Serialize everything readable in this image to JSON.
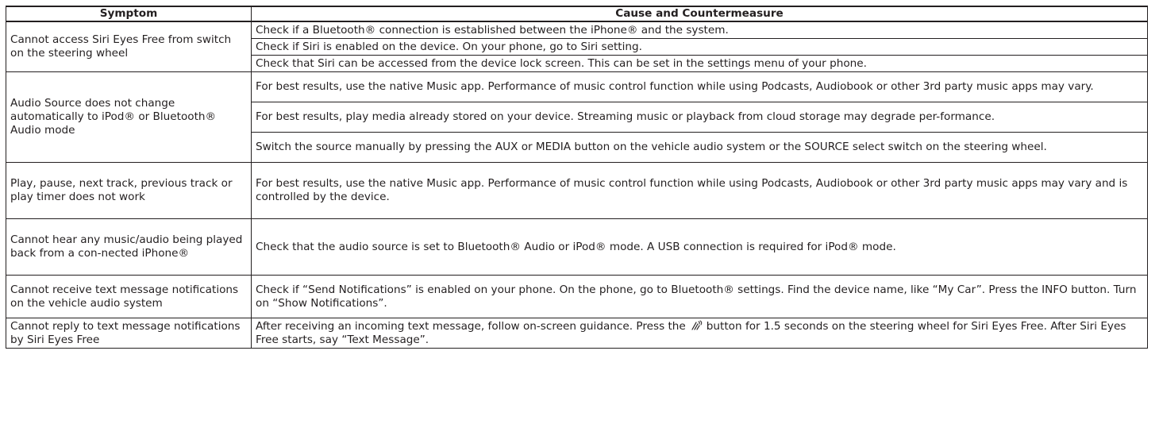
{
  "headers": {
    "symptom": "Symptom",
    "cause": "Cause and Countermeasure"
  },
  "rows": [
    {
      "symptom": "Cannot access Siri Eyes Free from switch on the steering wheel",
      "causes": [
        "Check if a Bluetooth® connection is established between the iPhone® and the system.",
        "Check if Siri is enabled on the device. On your phone, go to Siri setting.",
        "Check that Siri can be accessed from the device lock screen. This can be set in the settings menu of your phone."
      ]
    },
    {
      "symptom": "Audio Source does not change automatically to iPod® or Bluetooth® Audio mode",
      "causes": [
        "For best results, use the native Music app. Performance of music control function while using Podcasts, Audiobook or other 3rd party music apps may vary.",
        "For best results, play media already stored on your device. Streaming music or playback from cloud storage may degrade per-formance.",
        "Switch the source manually by pressing the AUX or MEDIA button on the vehicle audio system or the SOURCE select switch on the steering wheel."
      ]
    },
    {
      "symptom": "Play, pause, next track, previous track or play timer does not work",
      "causes": [
        "For best results, use the native Music app. Performance of music control function while using Podcasts, Audiobook or other 3rd party music apps may vary and is controlled by the device."
      ]
    },
    {
      "symptom": "Cannot hear any music/audio being played back from a con-nected iPhone®",
      "causes": [
        "Check that the audio source is set to Bluetooth® Audio or iPod® mode. A USB connection is required for iPod® mode."
      ]
    },
    {
      "symptom": "Cannot receive text message notifications on the vehicle audio system",
      "causes": [
        "Check if “Send Notifications” is enabled on your phone. On the phone, go to Bluetooth® settings. Find the device name, like “My Car”. Press the INFO button. Turn on “Show Notifications”."
      ]
    },
    {
      "symptom": "Cannot reply to text message notifications by Siri Eyes Free",
      "cause_before_icon": "After receiving an incoming text message, follow on-screen guidance. Press the",
      "cause_icon": "voice-command-icon",
      "cause_after_icon": "button for 1.5 seconds on the steering wheel for Siri Eyes Free. After Siri Eyes Free starts, say “Text Message”."
    }
  ]
}
